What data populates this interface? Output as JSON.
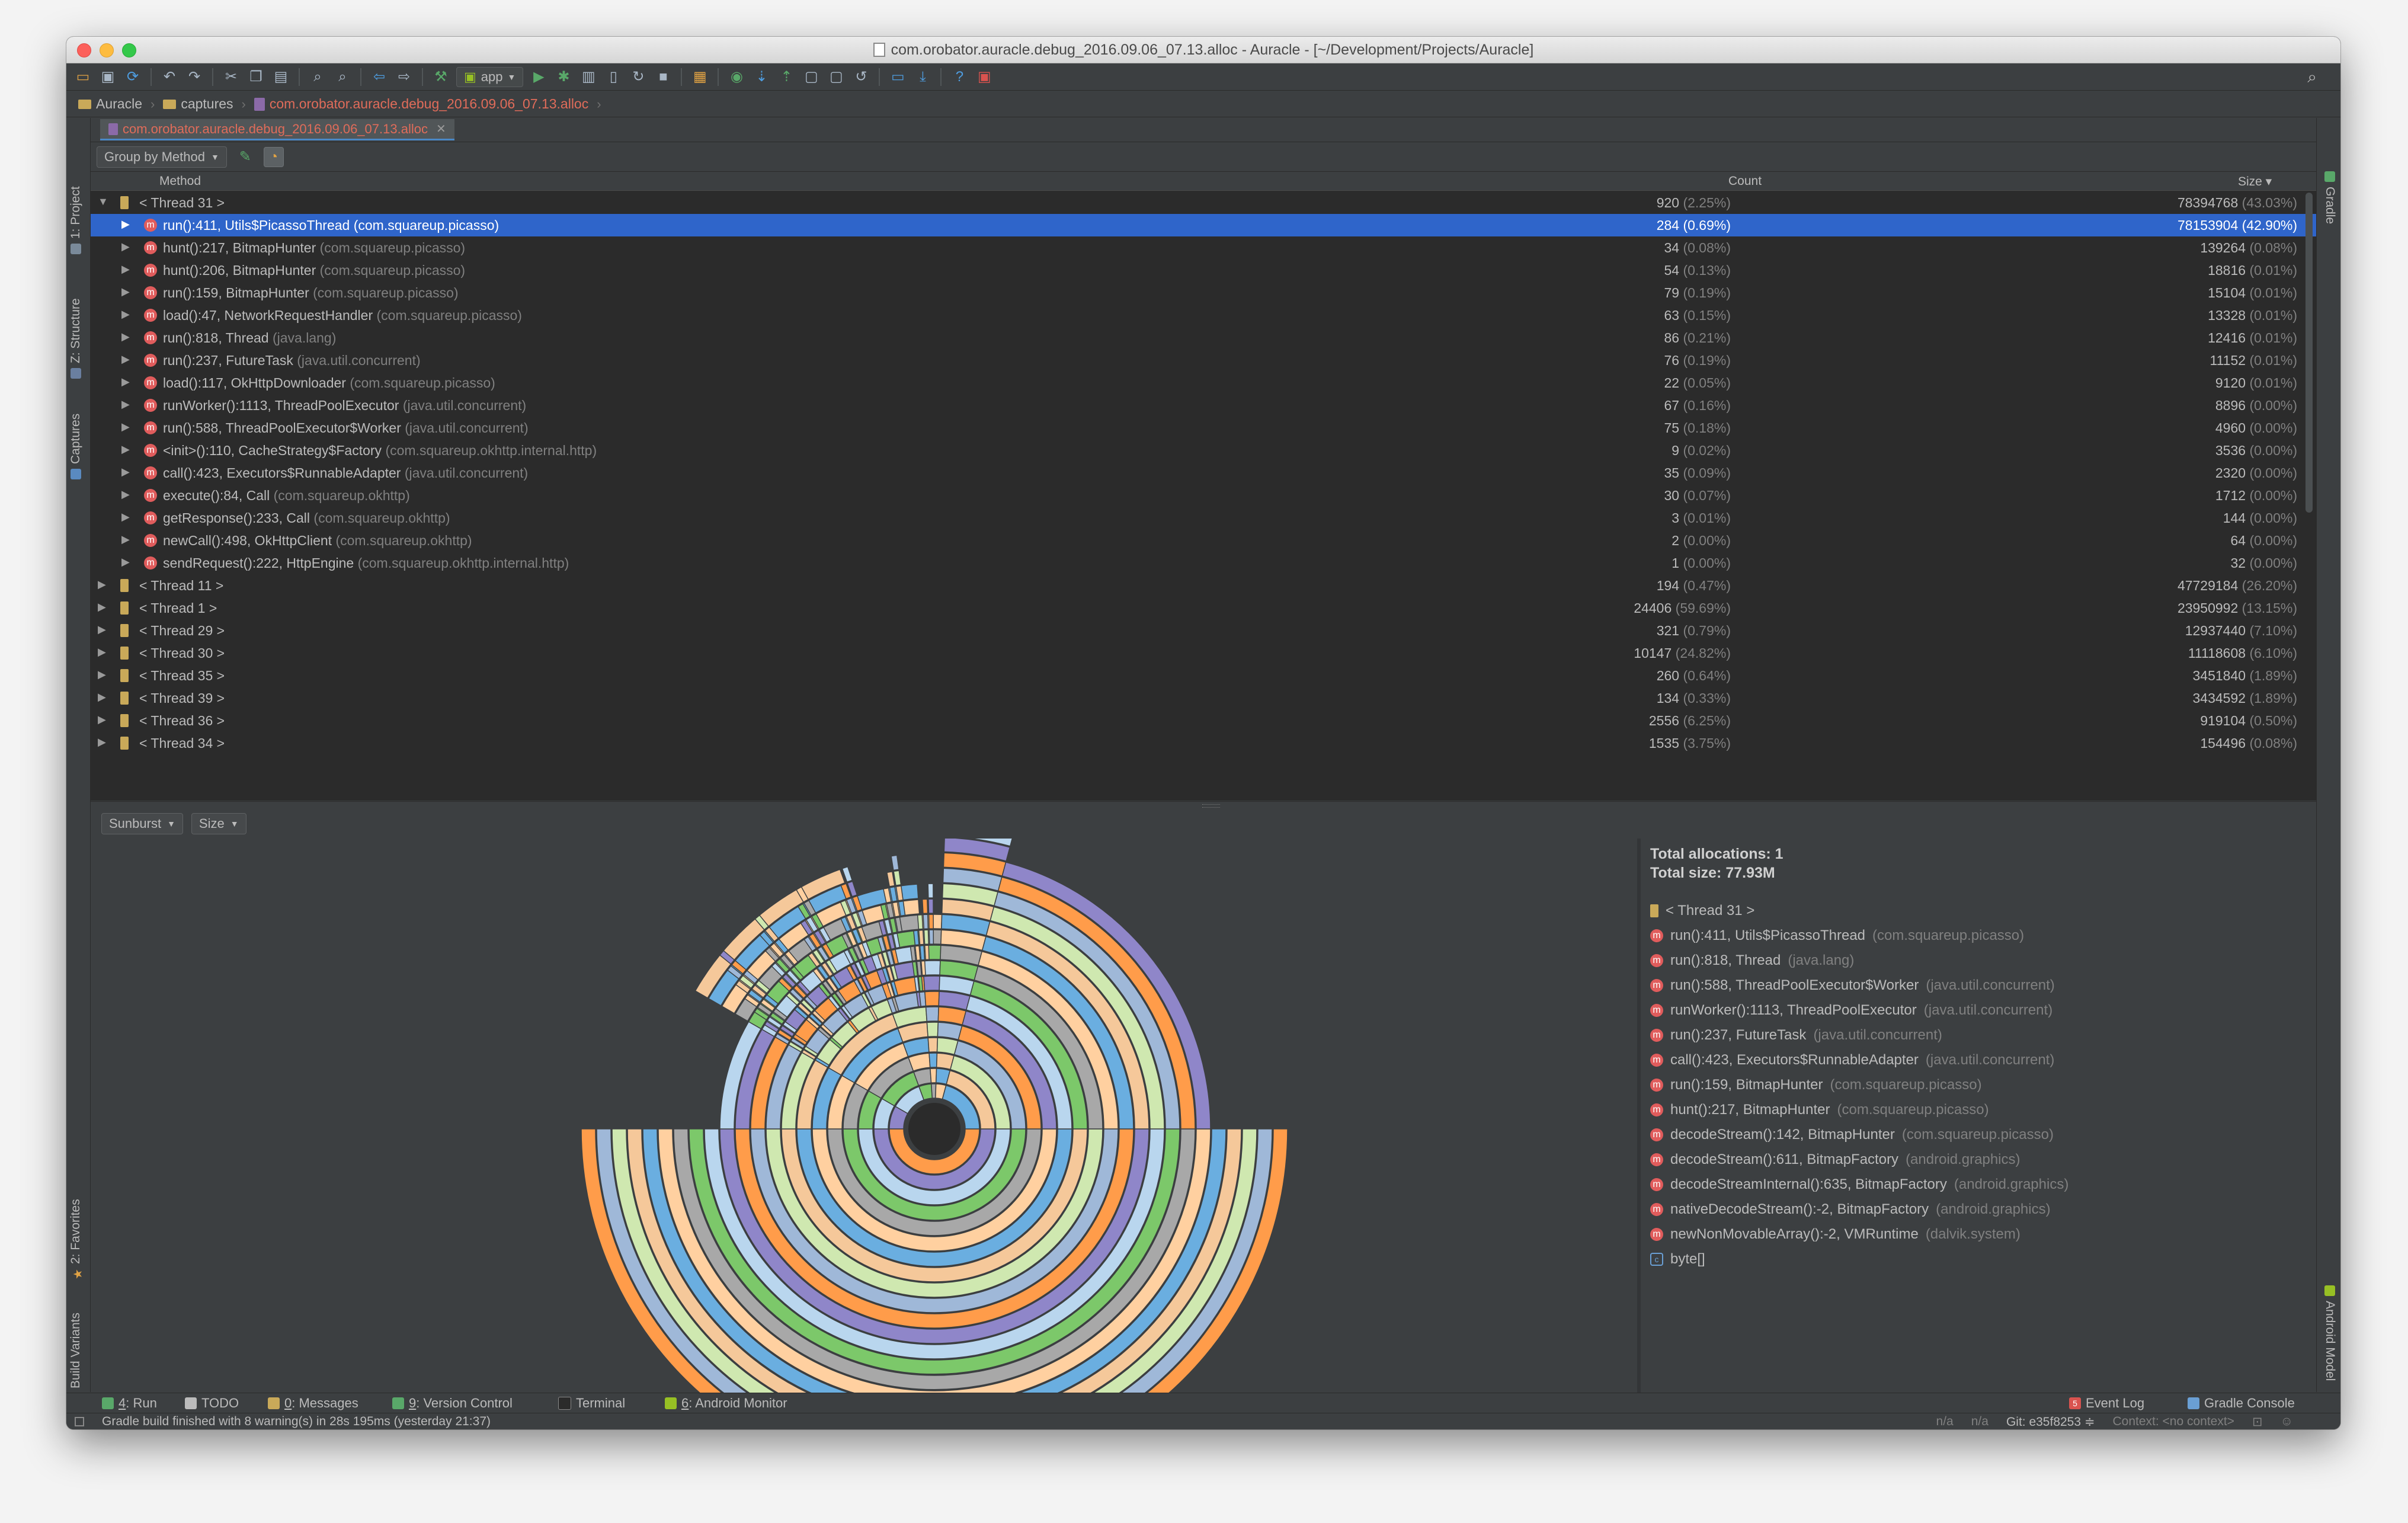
{
  "window": {
    "title": "com.orobator.auracle.debug_2016.09.06_07.13.alloc - Auracle - [~/Development/Projects/Auracle]"
  },
  "toolbar": {
    "run_config": "app"
  },
  "breadcrumb": [
    {
      "label": "Auracle",
      "icon": "folder-icon"
    },
    {
      "label": "captures",
      "icon": "folder-icon"
    },
    {
      "label": "com.orobator.auracle.debug_2016.09.06_07.13.alloc",
      "icon": "alloc-file-icon"
    }
  ],
  "left_tools": {
    "project": "1: Project",
    "structure": "Z: Structure",
    "captures": "Captures",
    "favorites": "2: Favorites",
    "build_variants": "Build Variants"
  },
  "right_tools": {
    "gradle": "Gradle",
    "android_model": "Android Model"
  },
  "editor_tab": {
    "label": "com.orobator.auracle.debug_2016.09.06_07.13.alloc"
  },
  "options": {
    "group_by": "Group by Method"
  },
  "table": {
    "headers": {
      "method": "Method",
      "count": "Count",
      "size": "Size ▾"
    },
    "rows": [
      {
        "level": 0,
        "kind": "thread",
        "expanded": true,
        "name": "< Thread 31 >",
        "pkg": "",
        "count": "920",
        "count_pct": "(2.25%)",
        "size": "78394768",
        "size_pct": "(43.03%)"
      },
      {
        "level": 1,
        "kind": "method",
        "selected": true,
        "name": "run():411, Utils$PicassoThread",
        "pkg": "(com.squareup.picasso)",
        "count": "284",
        "count_pct": "(0.69%)",
        "size": "78153904",
        "size_pct": "(42.90%)"
      },
      {
        "level": 1,
        "kind": "method",
        "name": "hunt():217, BitmapHunter",
        "pkg": "(com.squareup.picasso)",
        "count": "34",
        "count_pct": "(0.08%)",
        "size": "139264",
        "size_pct": "(0.08%)"
      },
      {
        "level": 1,
        "kind": "method",
        "name": "hunt():206, BitmapHunter",
        "pkg": "(com.squareup.picasso)",
        "count": "54",
        "count_pct": "(0.13%)",
        "size": "18816",
        "size_pct": "(0.01%)"
      },
      {
        "level": 1,
        "kind": "method",
        "name": "run():159, BitmapHunter",
        "pkg": "(com.squareup.picasso)",
        "count": "79",
        "count_pct": "(0.19%)",
        "size": "15104",
        "size_pct": "(0.01%)"
      },
      {
        "level": 1,
        "kind": "method",
        "name": "load():47, NetworkRequestHandler",
        "pkg": "(com.squareup.picasso)",
        "count": "63",
        "count_pct": "(0.15%)",
        "size": "13328",
        "size_pct": "(0.01%)"
      },
      {
        "level": 1,
        "kind": "method",
        "name": "run():818, Thread",
        "pkg": "(java.lang)",
        "count": "86",
        "count_pct": "(0.21%)",
        "size": "12416",
        "size_pct": "(0.01%)"
      },
      {
        "level": 1,
        "kind": "method",
        "name": "run():237, FutureTask",
        "pkg": "(java.util.concurrent)",
        "count": "76",
        "count_pct": "(0.19%)",
        "size": "11152",
        "size_pct": "(0.01%)"
      },
      {
        "level": 1,
        "kind": "method",
        "name": "load():117, OkHttpDownloader",
        "pkg": "(com.squareup.picasso)",
        "count": "22",
        "count_pct": "(0.05%)",
        "size": "9120",
        "size_pct": "(0.01%)"
      },
      {
        "level": 1,
        "kind": "method",
        "name": "runWorker():1113, ThreadPoolExecutor",
        "pkg": "(java.util.concurrent)",
        "count": "67",
        "count_pct": "(0.16%)",
        "size": "8896",
        "size_pct": "(0.00%)"
      },
      {
        "level": 1,
        "kind": "method",
        "name": "run():588, ThreadPoolExecutor$Worker",
        "pkg": "(java.util.concurrent)",
        "count": "75",
        "count_pct": "(0.18%)",
        "size": "4960",
        "size_pct": "(0.00%)"
      },
      {
        "level": 1,
        "kind": "method",
        "name": "<init>():110, CacheStrategy$Factory",
        "pkg": "(com.squareup.okhttp.internal.http)",
        "count": "9",
        "count_pct": "(0.02%)",
        "size": "3536",
        "size_pct": "(0.00%)"
      },
      {
        "level": 1,
        "kind": "method",
        "name": "call():423, Executors$RunnableAdapter",
        "pkg": "(java.util.concurrent)",
        "count": "35",
        "count_pct": "(0.09%)",
        "size": "2320",
        "size_pct": "(0.00%)"
      },
      {
        "level": 1,
        "kind": "method",
        "name": "execute():84, Call",
        "pkg": "(com.squareup.okhttp)",
        "count": "30",
        "count_pct": "(0.07%)",
        "size": "1712",
        "size_pct": "(0.00%)"
      },
      {
        "level": 1,
        "kind": "method",
        "name": "getResponse():233, Call",
        "pkg": "(com.squareup.okhttp)",
        "count": "3",
        "count_pct": "(0.01%)",
        "size": "144",
        "size_pct": "(0.00%)"
      },
      {
        "level": 1,
        "kind": "method",
        "name": "newCall():498, OkHttpClient",
        "pkg": "(com.squareup.okhttp)",
        "count": "2",
        "count_pct": "(0.00%)",
        "size": "64",
        "size_pct": "(0.00%)"
      },
      {
        "level": 1,
        "kind": "method",
        "name": "sendRequest():222, HttpEngine",
        "pkg": "(com.squareup.okhttp.internal.http)",
        "count": "1",
        "count_pct": "(0.00%)",
        "size": "32",
        "size_pct": "(0.00%)"
      },
      {
        "level": 0,
        "kind": "thread",
        "name": "< Thread 11 >",
        "pkg": "",
        "count": "194",
        "count_pct": "(0.47%)",
        "size": "47729184",
        "size_pct": "(26.20%)"
      },
      {
        "level": 0,
        "kind": "thread",
        "name": "< Thread 1 >",
        "pkg": "",
        "count": "24406",
        "count_pct": "(59.69%)",
        "size": "23950992",
        "size_pct": "(13.15%)"
      },
      {
        "level": 0,
        "kind": "thread",
        "name": "< Thread 29 >",
        "pkg": "",
        "count": "321",
        "count_pct": "(0.79%)",
        "size": "12937440",
        "size_pct": "(7.10%)"
      },
      {
        "level": 0,
        "kind": "thread",
        "name": "< Thread 30 >",
        "pkg": "",
        "count": "10147",
        "count_pct": "(24.82%)",
        "size": "11118608",
        "size_pct": "(6.10%)"
      },
      {
        "level": 0,
        "kind": "thread",
        "name": "< Thread 35 >",
        "pkg": "",
        "count": "260",
        "count_pct": "(0.64%)",
        "size": "3451840",
        "size_pct": "(1.89%)"
      },
      {
        "level": 0,
        "kind": "thread",
        "name": "< Thread 39 >",
        "pkg": "",
        "count": "134",
        "count_pct": "(0.33%)",
        "size": "3434592",
        "size_pct": "(1.89%)"
      },
      {
        "level": 0,
        "kind": "thread",
        "name": "< Thread 36 >",
        "pkg": "",
        "count": "2556",
        "count_pct": "(6.25%)",
        "size": "919104",
        "size_pct": "(0.50%)"
      },
      {
        "level": 0,
        "kind": "thread",
        "name": "< Thread 34 >",
        "pkg": "",
        "count": "1535",
        "count_pct": "(3.75%)",
        "size": "154496",
        "size_pct": "(0.08%)"
      }
    ]
  },
  "chart_options": {
    "chart_type": "Sunburst",
    "metric": "Size"
  },
  "sunburst": {
    "colors": [
      "#ff9c4a",
      "#8f86c9",
      "#b9d6ee",
      "#7cc86a",
      "#a8a8a8",
      "#ffd0a0",
      "#6aaee0",
      "#f5c89a",
      "#cfe8b0",
      "#9fb8d8"
    ]
  },
  "details": {
    "total_allocations": "Total allocations: 1",
    "total_size": "Total size: 77.93M",
    "stack": [
      {
        "kind": "thread",
        "name": "< Thread 31 >",
        "pkg": ""
      },
      {
        "kind": "method",
        "name": "run():411, Utils$PicassoThread",
        "pkg": "(com.squareup.picasso)"
      },
      {
        "kind": "method",
        "name": "run():818, Thread",
        "pkg": "(java.lang)"
      },
      {
        "kind": "method",
        "name": "run():588, ThreadPoolExecutor$Worker",
        "pkg": "(java.util.concurrent)"
      },
      {
        "kind": "method",
        "name": "runWorker():1113, ThreadPoolExecutor",
        "pkg": "(java.util.concurrent)"
      },
      {
        "kind": "method",
        "name": "run():237, FutureTask",
        "pkg": "(java.util.concurrent)"
      },
      {
        "kind": "method",
        "name": "call():423, Executors$RunnableAdapter",
        "pkg": "(java.util.concurrent)"
      },
      {
        "kind": "method",
        "name": "run():159, BitmapHunter",
        "pkg": "(com.squareup.picasso)"
      },
      {
        "kind": "method",
        "name": "hunt():217, BitmapHunter",
        "pkg": "(com.squareup.picasso)"
      },
      {
        "kind": "method",
        "name": "decodeStream():142, BitmapHunter",
        "pkg": "(com.squareup.picasso)"
      },
      {
        "kind": "method",
        "name": "decodeStream():611, BitmapFactory",
        "pkg": "(android.graphics)"
      },
      {
        "kind": "method",
        "name": "decodeStreamInternal():635, BitmapFactory",
        "pkg": "(android.graphics)"
      },
      {
        "kind": "method",
        "name": "nativeDecodeStream():-2, BitmapFactory",
        "pkg": "(android.graphics)"
      },
      {
        "kind": "method",
        "name": "newNonMovableArray():-2, VMRuntime",
        "pkg": "(dalvik.system)"
      },
      {
        "kind": "class",
        "name": "byte[]",
        "pkg": ""
      }
    ]
  },
  "bottom_tools": [
    {
      "prefix": "4",
      "label": ": Run",
      "icon": "run-icon",
      "color": "#59a869"
    },
    {
      "prefix": "",
      "label": "TODO",
      "icon": "todo-icon",
      "color": "#bbbbbb"
    },
    {
      "prefix": "0",
      "label": ": Messages",
      "icon": "messages-icon",
      "color": "#c9a959"
    },
    {
      "prefix": "9",
      "label": ": Version Control",
      "icon": "version-control-icon",
      "color": "#59a869"
    },
    {
      "prefix": "",
      "label": "Terminal",
      "icon": "terminal-icon",
      "color": "#2b2b2b"
    },
    {
      "prefix": "6",
      "label": ": Android Monitor",
      "icon": "android-monitor-icon",
      "color": "#97c024"
    }
  ],
  "bottom_tools_right": {
    "event_log": "Event Log",
    "event_log_badge": "5",
    "gradle_console": "Gradle Console"
  },
  "status": {
    "message": "Gradle build finished with 8 warning(s) in 28s 195ms (yesterday 21:37)",
    "na1": "n/a",
    "na2": "n/a",
    "git": "Git: e35f8253 ≑",
    "context": "Context: <no context>"
  }
}
